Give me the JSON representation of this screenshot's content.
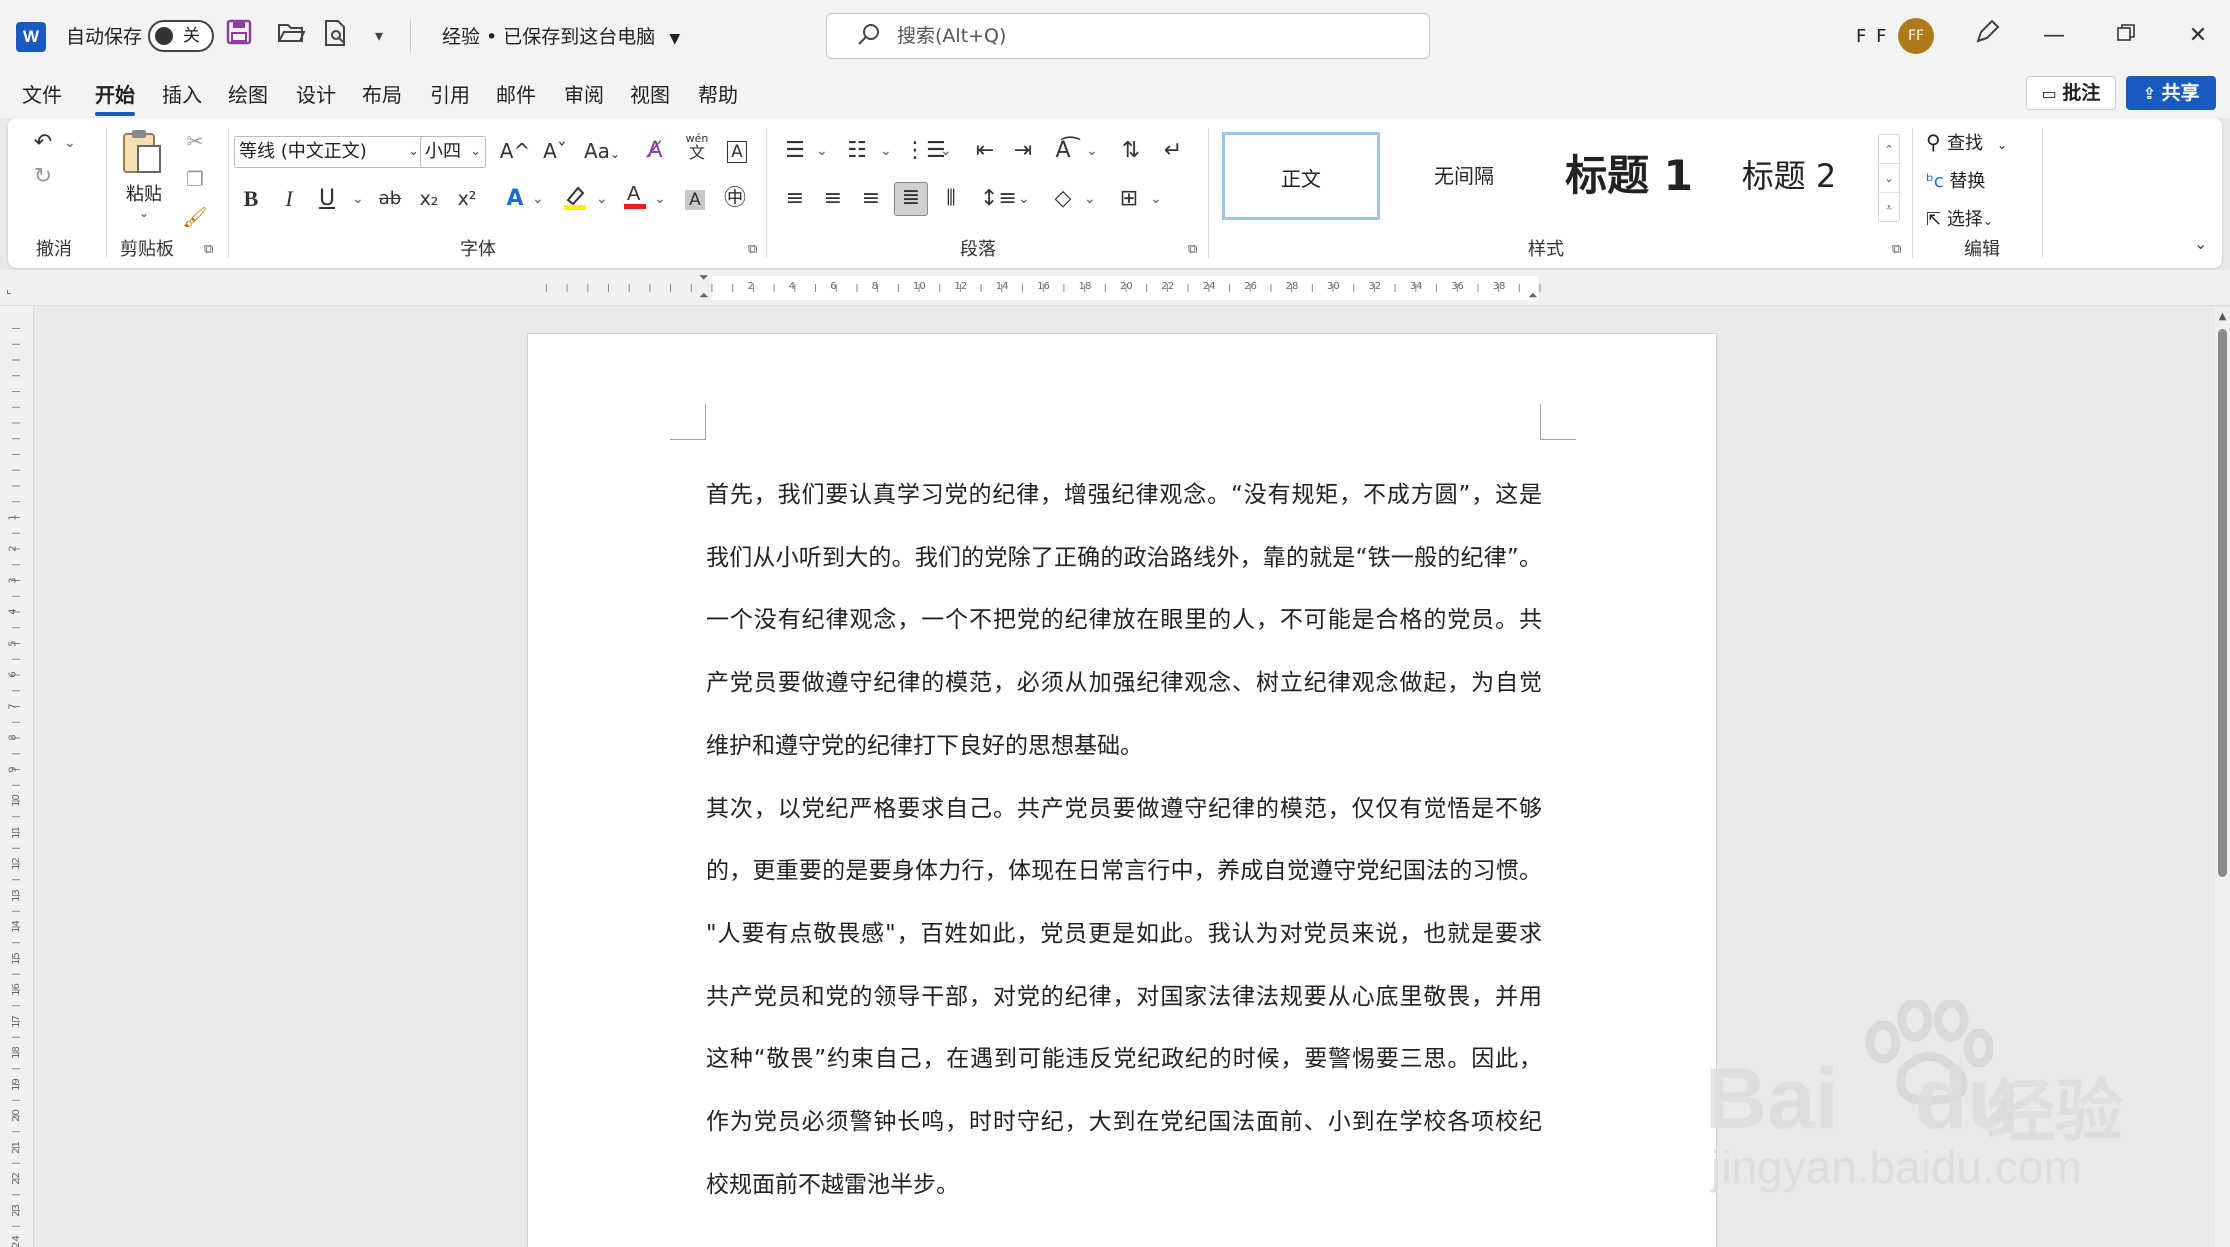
{
  "titlebar": {
    "app_logo": "W",
    "autosave_label": "自动保存",
    "autosave_state": "关",
    "doc_title": "经验 • 已保存到这台电脑",
    "search_placeholder": "搜索(Alt+Q)",
    "user_initials": "F F",
    "avatar_initials": "FF",
    "icons": [
      "save-icon",
      "open-folder-icon",
      "print-preview-icon",
      "customize-toolbar-icon",
      "pen-icon",
      "minimize-icon",
      "restore-icon",
      "close-icon"
    ]
  },
  "tabs": {
    "items": [
      "文件",
      "开始",
      "插入",
      "绘图",
      "设计",
      "布局",
      "引用",
      "邮件",
      "审阅",
      "视图",
      "帮助"
    ],
    "active": "开始",
    "comment_label": "批注",
    "share_label": "共享"
  },
  "ribbon": {
    "groups": {
      "undo": "撤消",
      "clipboard": "剪贴板",
      "font": "字体",
      "paragraph": "段落",
      "styles": "样式",
      "editing": "编辑"
    },
    "paste_label": "粘贴",
    "font_name": "等线 (中文正文)",
    "font_size": "小四",
    "font_grow": "A^",
    "font_shrink": "Aˇ",
    "change_case": "Aa",
    "phonetic": "wén",
    "bold": "B",
    "italic": "I",
    "underline": "U",
    "strike": "ab",
    "subscript": "x₂",
    "superscript": "x²",
    "styles": [
      "正文",
      "无间隔",
      "标题 1",
      "标题 2"
    ],
    "find_label": "查找",
    "replace_label": "替换",
    "select_label": "选择"
  },
  "ruler": {
    "h_labels": [
      "2",
      "4",
      "6",
      "8",
      "10",
      "12",
      "14",
      "16",
      "18",
      "20",
      "22",
      "24",
      "26",
      "28",
      "30",
      "32",
      "34",
      "36",
      "38"
    ],
    "v_labels": [
      "1",
      "2",
      "3",
      "4",
      "5",
      "6",
      "7",
      "8",
      "9",
      "10",
      "11",
      "12",
      "13",
      "14",
      "15",
      "16",
      "17",
      "18",
      "19",
      "20",
      "21",
      "22",
      "23",
      "24"
    ]
  },
  "document": {
    "paragraphs": [
      [
        "首先，我们要认真学习党的纪律，增强纪律观念。“没有规矩，不成方圆”，这是",
        "我们从小听到大的。我们的党除了正确的政治路线外，靠的就是“铁一般的纪律”。",
        "一个没有纪律观念，一个不把党的纪律放在眼里的人，不可能是合格的党员。共",
        "产党员要做遵守纪律的模范，必须从加强纪律观念、树立纪律观念做起，为自觉",
        "维护和遵守党的纪律打下良好的思想基础。"
      ],
      [
        "其次，以党纪严格要求自己。共产党员要做遵守纪律的模范，仅仅有觉悟是不够",
        "的，更重要的是要身体力行，体现在日常言行中，养成自觉遵守党纪国法的习惯。",
        "\"人要有点敬畏感\"，百姓如此，党员更是如此。我认为对党员来说，也就是要求",
        "共产党员和党的领导干部，对党的纪律，对国家法律法规要从心底里敬畏，并用",
        "这种“敬畏”约束自己，在遇到可能违反党纪政纪的时候，要警惕要三思。因此，",
        "作为党员必须警钟长鸣，时时守纪，大到在党纪国法面前、小到在学校各项校纪",
        "校规面前不越雷池半步。"
      ]
    ]
  },
  "watermark": {
    "brand_latin": "Bai",
    "brand_latin2": "du",
    "brand_cn": "经验",
    "url": "jingyan.baidu.com"
  }
}
